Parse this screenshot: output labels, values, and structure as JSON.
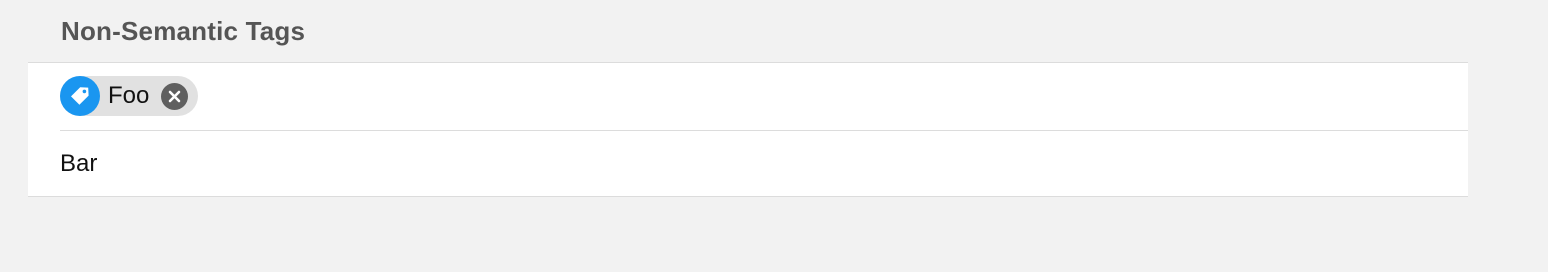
{
  "section": {
    "title": "Non-Semantic Tags"
  },
  "tags": [
    {
      "label": "Foo",
      "icon": "tag-icon",
      "remove_icon": "close-circle-icon"
    }
  ],
  "input": {
    "value": "Bar"
  },
  "colors": {
    "background": "#f2f2f2",
    "panel": "#ffffff",
    "header_text": "#555555",
    "tag_icon_bg": "#1a96f0",
    "chip_bg": "#e1e1e1",
    "remove_bg": "#5f5f5f"
  }
}
